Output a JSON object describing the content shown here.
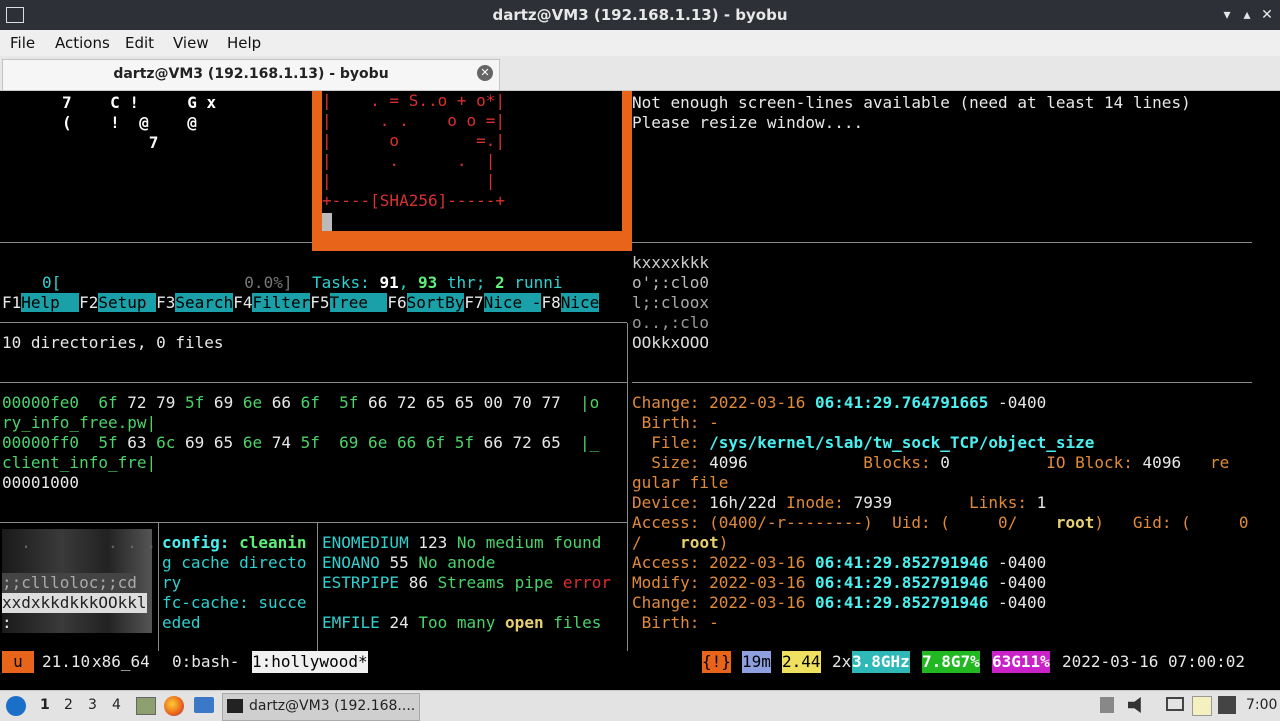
{
  "window": {
    "title": "dartz@VM3 (192.168.1.13) - byobu",
    "minimize_glyph": "▾",
    "maximize_glyph": "▴",
    "close_glyph": "✕"
  },
  "menu": [
    "File",
    "Actions",
    "Edit",
    "View",
    "Help"
  ],
  "tab": {
    "label": "dartz@VM3 (192.168.1.13) - byobu"
  },
  "hollywood": {
    "art_lines": [
      "7    C !     G x",
      "(    !  @    @",
      "         7"
    ],
    "sshkey_lines": [
      "|    . = S..o + o*|",
      "|     . .    o o =|",
      "|      o        =.|",
      "|      .      .  |",
      "|                |",
      "+----[SHA256]-----+"
    ],
    "htop": {
      "cpu_label": "0[",
      "cpu_pct": "0.0%]",
      "tasks_label": "Tasks: ",
      "tasks_count": "91",
      "tasks_sep": ", ",
      "thr_count": "93",
      "thr_text": " thr; ",
      "run_count": "2",
      "run_text": " runni",
      "fkeys": [
        {
          "key": "F1",
          "label": "Help  "
        },
        {
          "key": "F2",
          "label": "Setup "
        },
        {
          "key": "F3",
          "label": "Search"
        },
        {
          "key": "F4",
          "label": "Filter"
        },
        {
          "key": "F5",
          "label": "Tree  "
        },
        {
          "key": "F6",
          "label": "SortBy"
        },
        {
          "key": "F7",
          "label": "Nice -"
        },
        {
          "key": "F8",
          "label": "Nice"
        }
      ]
    },
    "tree_summary": "10 directories, 0 files",
    "hexdump": [
      {
        "addr": "00000fe0",
        "bytes_g": "6f",
        "bytes_w": " 72 79 ",
        "bytes_g2": "5f",
        "bytes_w2": " 69 ",
        "bytes_g3": "6e",
        "bytes_w3": " 66 ",
        "bytes_g4": "6f  5f",
        "bytes_w4": " 66 72 65 65 00 70 77  ",
        "ascii": "|o"
      },
      {
        "addr": "",
        "bytes_g": "",
        "bytes_w": "",
        "bytes_g2": "",
        "bytes_w2": "",
        "bytes_g3": "",
        "bytes_w3": "",
        "bytes_g4": "",
        "bytes_w4": "",
        "ascii": "ry_info_free.pw|"
      },
      {
        "addr": "00000ff0",
        "bytes_g": "5f",
        "bytes_w": " 63 ",
        "bytes_g2": "6c",
        "bytes_w2": " 69 65 ",
        "bytes_g3": "6e",
        "bytes_w3": " 74 ",
        "bytes_g4": "5f  69 6e 66 6f 5f",
        "bytes_w4": " 66 72 65  ",
        "ascii": "|_"
      },
      {
        "addr": "",
        "bytes_g": "",
        "bytes_w": "",
        "bytes_g2": "",
        "bytes_w2": "",
        "bytes_g3": "",
        "bytes_w3": "",
        "bytes_g4": "",
        "bytes_w4": "",
        "ascii": "client_info_fre|"
      }
    ],
    "hexdump_end": "00001000",
    "ascii_img_left": [
      "  .        . . .",
      "",
      ";;clllolоc;;cd",
      "xxdxkkdkkkOOkkl",
      ":"
    ],
    "config_lines": [
      "config: cleanin",
      "g cache directo",
      "ry",
      "fc-cache: succe",
      "eded"
    ],
    "errno": [
      {
        "name": "ENOMEDIUM",
        "num": "123",
        "desc_a": "No medium found",
        "desc_b": ""
      },
      {
        "name": "ENOANO",
        "num": "55",
        "desc_a": "No anode",
        "desc_b": ""
      },
      {
        "name": "ESTRPIPE",
        "num": "86",
        "desc_a": "Streams pipe ",
        "desc_b": "error"
      },
      {
        "name": "EMFILE",
        "num": "24",
        "desc_a": "Too many ",
        "desc_b": "open",
        "desc_c": " files"
      }
    ],
    "resize_msg": [
      "Not enough screen-lines available (need at least 14 lines)",
      "Please resize window...."
    ],
    "ascii_img_right": [
      "kxxxxkkk",
      "o';:clo0",
      "l;:cloox",
      "o..,:clo",
      "OOkkxOOO"
    ],
    "stat": {
      "change1_label": "Change: ",
      "change1_date": "2022-03-16 ",
      "change1_time": "06:41:29.764791665",
      "change1_tz": " -0400",
      "birth1": " Birth: -",
      "file_label": "  File: ",
      "file_path": "/sys/kernel/slab/tw_sock_TCP/object_size",
      "size_label": "  Size: ",
      "size_val": "4096",
      "blocks_label": "            Blocks: ",
      "blocks_val": "0",
      "ioblock_label": "          IO Block: ",
      "ioblock_val": "4096",
      "type_a": "   re",
      "type_b": "gular file",
      "device_label": "Device: ",
      "device_val": "16h/22d",
      "inode_label": " Inode: ",
      "inode_val": "7939",
      "links_label": "        Links: ",
      "links_val": "1",
      "access_label": "Access: ",
      "access_mode": "(0400/-r--------)",
      "uid_label": "  Uid: (     0/    ",
      "uid_name": "root",
      "gid_label": ")   Gid: (     0",
      "gid_cont": "/    ",
      "gid_name": "root",
      "gid_end": ")",
      "atime_label": "Access: ",
      "atime_date": "2022-03-16 ",
      "atime_time": "06:41:29.852791946",
      "atime_tz": " -0400",
      "mtime_label": "Modify: ",
      "mtime_date": "2022-03-16 ",
      "mtime_time": "06:41:29.852791946",
      "mtime_tz": " -0400",
      "ctime_label": "Change: ",
      "ctime_date": "2022-03-16 ",
      "ctime_time": "06:41:29.852791946",
      "ctime_tz": " -0400",
      "birth2": " Birth: -"
    }
  },
  "statusbar": {
    "mode": "u",
    "release": "21.10",
    "arch": "x86_64",
    "win0": "0:bash-",
    "win1": "1:hollywood*",
    "alert": "{!}",
    "uptime": "19m",
    "load": "2.44",
    "cpu_count": "2x",
    "cpu_freq": "3.8GHz",
    "mem": "7.8G7%",
    "disk": "63G11%",
    "datetime": "2022-03-16 07:00:02",
    "colors": {
      "mode_bg": "#e8641a",
      "alert_bg": "#e8641a",
      "uptime_bg": "#8fa0e0",
      "load_bg": "#f0e060",
      "freq_bg": "#2fb8b8",
      "mem_bg": "#22b822",
      "disk_bg": "#c822c8"
    }
  },
  "taskbar": {
    "workspaces": [
      "1",
      "2",
      "3",
      "4"
    ],
    "task_label": "dartz@VM3 (192.168....",
    "clock": "7:00"
  }
}
